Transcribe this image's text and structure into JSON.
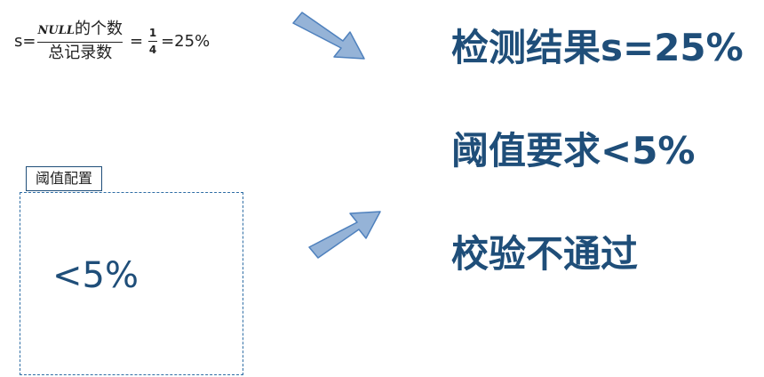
{
  "formula": {
    "lhs": "s=",
    "numerator_italic": "NULL",
    "numerator_text": "的个数",
    "denominator": "总记录数",
    "eq1": "=",
    "small_num": "1",
    "small_den": "4",
    "eq2": "=25%"
  },
  "config": {
    "label": "阈值配置",
    "value": "<5%"
  },
  "results": [
    "检测结果s=25%",
    "阈值要求<5%",
    "校验不通过"
  ],
  "colors": {
    "text_blue": "#1f4e79",
    "arrow_fill": "#95b3d7",
    "arrow_stroke": "#4f81bd"
  }
}
